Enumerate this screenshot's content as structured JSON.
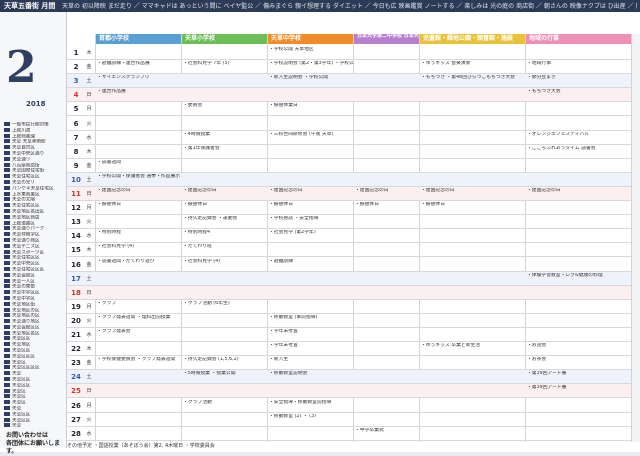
{
  "header": {
    "title": "天草五番街 月間",
    "topics": "天草の 初以降映 まだ走り ／ ママキャドは あっという間に ベイヤ監公 ／ 傷みまぐら 親イ想理する ダイエット ／ 今日も広 映画鑑賞 ノートする ／ 楽しみは 光の庭の 商店街 ／ 朝さんの 映像ナクブは ひ出産 ／ 阿含・谷山 真選宝遊産が 資稀する ／ 国はどこ Youは天草 何をですか"
  },
  "calendar": {
    "month": "2",
    "year": "2018"
  },
  "columns": [
    {
      "label": "首都小学校",
      "color": "#5a9fd4"
    },
    {
      "label": "天草小学校",
      "color": "#6cbf57"
    },
    {
      "label": "天草中学校",
      "color": "#f08c2a"
    },
    {
      "label": "日本大学第二中学校 日本大学第二高等学校",
      "color": "#b77fcf"
    },
    {
      "label": "児童館・緑地公園・図書館・施設",
      "color": "#e8c239"
    },
    {
      "label": "地域の行事",
      "color": "#ef8fb5"
    }
  ],
  "legend": [
    "一般市民行開対策",
    "上総川渡 ",
    "上総商業課",
    "天草 天草美術館",
    "天草自然区",
    "天草中央区通り",
    "天草通リ",
    "八百屋商店街",
    "天草国際住宅街",
    "天草住宅区区",
    "天草の光リ",
    "パンケキ天草住宅区",
    "上水東商業区",
    "天草の太陽",
    "天草住宅区区",
    "天草地区名田区",
    "天草地区商店",
    "上総道路区",
    "天草通りパーク",
    "天草仲間学区",
    "天草通り商区",
    "天草テニス区",
    "天草スポーツ区",
    "天草住宅区区",
    "天草中央区区",
    "天草住宅区区区",
    "天草会館区",
    "天草一人区",
    "天草の東部",
    "天草中学区区",
    "天草中学区",
    "天草地区街",
    "天草地区の区",
    "天草地区の区",
    "天草通り地区",
    "天草会館区区",
    "天草地区名区",
    "天草区区",
    "天草地区",
    "天草区区",
    "天草区区区",
    "天草区",
    "天草区区区区",
    "天草",
    "天草区区",
    "天草区区",
    "天草区",
    "天草区",
    "天草区",
    "天草",
    "天草区区",
    "天草区区",
    "天草"
  ],
  "contact": [
    "お問い合わせは",
    "各団体にお願いします。"
  ],
  "days": [
    {
      "d": "1",
      "w": "木",
      "c": [
        "",
        "",
        "学校公開 天草地区",
        "",
        "",
        ""
      ]
    },
    {
      "d": "2",
      "w": "金",
      "c": [
        "避難訓練・連合作品展",
        "社会科見学 7年 (5)",
        "学校説明会 (第2・第3学年) ・学校公開",
        "",
        "ゆうキッズ 音楽演奏",
        "地域行事"
      ]
    },
    {
      "d": "3",
      "w": "土",
      "c": [
        "サイエンスグランプリ",
        "",
        "新入生説明会 ・学校公開",
        "",
        "もちつき ・第48回ひらつこもちつき大会",
        "節分豆まき"
      ]
    },
    {
      "d": "4",
      "w": "日",
      "c": [
        "連合作品展",
        "",
        "",
        "",
        "",
        "もちつき大会"
      ]
    },
    {
      "d": "5",
      "w": "月",
      "c": [
        "",
        "委員会",
        "振替休業日",
        "",
        "",
        ""
      ]
    },
    {
      "d": "6",
      "w": "火",
      "c": [
        "",
        "",
        "",
        "",
        "",
        ""
      ]
    },
    {
      "d": "7",
      "w": "水",
      "c": [
        "",
        "4時限授業",
        "三校合同研修会 (午後 天草)",
        "",
        "",
        "オレンジエフェスティバル"
      ]
    },
    {
      "d": "8",
      "w": "木",
      "c": [
        "",
        "第1年保護者会",
        "",
        "",
        "",
        "こころふれあうタイム 読書会"
      ]
    },
    {
      "d": "9",
      "w": "金",
      "c": [
        "読書週間",
        "",
        "",
        "",
        "",
        ""
      ]
    },
    {
      "d": "10",
      "w": "土",
      "c": [
        "学校公開・保護者会 選挙・作品展示",
        "",
        "",
        "",
        "",
        ""
      ]
    },
    {
      "d": "11",
      "w": "日",
      "c": [
        "建国記念の日",
        "建国記念の日",
        "建国記念の日",
        "建国記念の日",
        "建国記念の日",
        "建国記念の日"
      ]
    },
    {
      "d": "12",
      "w": "月",
      "c": [
        "振替休日",
        "振替休日",
        "振替休日",
        "振替休日",
        "振替休日",
        ""
      ]
    },
    {
      "d": "13",
      "w": "火",
      "c": [
        "",
        "持久走記録会 ・運動会",
        "学校懇談 ・安全指導",
        "",
        "",
        ""
      ]
    },
    {
      "d": "14",
      "w": "水",
      "c": [
        "特別時程",
        "特別時程4",
        "社会見学 (第2学年)",
        "",
        "",
        ""
      ]
    },
    {
      "d": "15",
      "w": "木",
      "c": [
        "社会科見学 (4)",
        "たてわり班",
        "",
        "",
        "",
        ""
      ]
    },
    {
      "d": "16",
      "w": "金",
      "c": [
        "読書週間・たてわり遊び",
        "社会科見学 (4)",
        "避難訓練",
        "",
        "",
        ""
      ]
    },
    {
      "d": "17",
      "w": "土",
      "c": [
        "",
        "",
        "",
        "",
        "",
        "体験学習教室・レク&健康の料理"
      ]
    },
    {
      "d": "18",
      "w": "日",
      "c": [
        "",
        "",
        "",
        "",
        "",
        ""
      ]
    },
    {
      "d": "19",
      "w": "月",
      "c": [
        "クラブ",
        "クラブ活動 (6年生)",
        "",
        "",
        "",
        ""
      ]
    },
    {
      "d": "20",
      "w": "火",
      "c": [
        "クラブ発表週間 ・理科出前授業",
        "",
        "移動教室 (事前指導)",
        "",
        "",
        ""
      ]
    },
    {
      "d": "21",
      "w": "水",
      "c": [
        "クラブ発表会",
        "",
        "学年末考査",
        "",
        "",
        ""
      ]
    },
    {
      "d": "22",
      "w": "木",
      "c": [
        "",
        "",
        "学年末考査",
        "",
        "ゆうキッズ 卒業と新生活",
        "お話会"
      ]
    },
    {
      "d": "23",
      "w": "金",
      "c": [
        "学校保健委員会 ・クラブ発表週間",
        "持久走記録会 (1,5,6,2)",
        "新入生",
        "",
        "",
        "お茶会"
      ]
    },
    {
      "d": "24",
      "w": "土",
      "c": [
        "",
        "5時限授業 ・授業公開",
        "移動教室説明会",
        "",
        "",
        "第39回アート展"
      ]
    },
    {
      "d": "25",
      "w": "日",
      "c": [
        "",
        "",
        "",
        "",
        "",
        "第39回アート展"
      ]
    },
    {
      "d": "26",
      "w": "月",
      "c": [
        "",
        "クラブ活動",
        "安全指導・移動教室前指導",
        "",
        "",
        ""
      ]
    },
    {
      "d": "27",
      "w": "火",
      "c": [
        "",
        "",
        "移動教室 (2) ・ (3)",
        "",
        "",
        ""
      ]
    },
    {
      "d": "28",
      "w": "水",
      "c": [
        "",
        "",
        "",
        "中学卒業式",
        "",
        ""
      ]
    }
  ],
  "footer": "その他予定 ・国語授業（あそぼう会）第2, 4木曜日 ・学校委員会"
}
